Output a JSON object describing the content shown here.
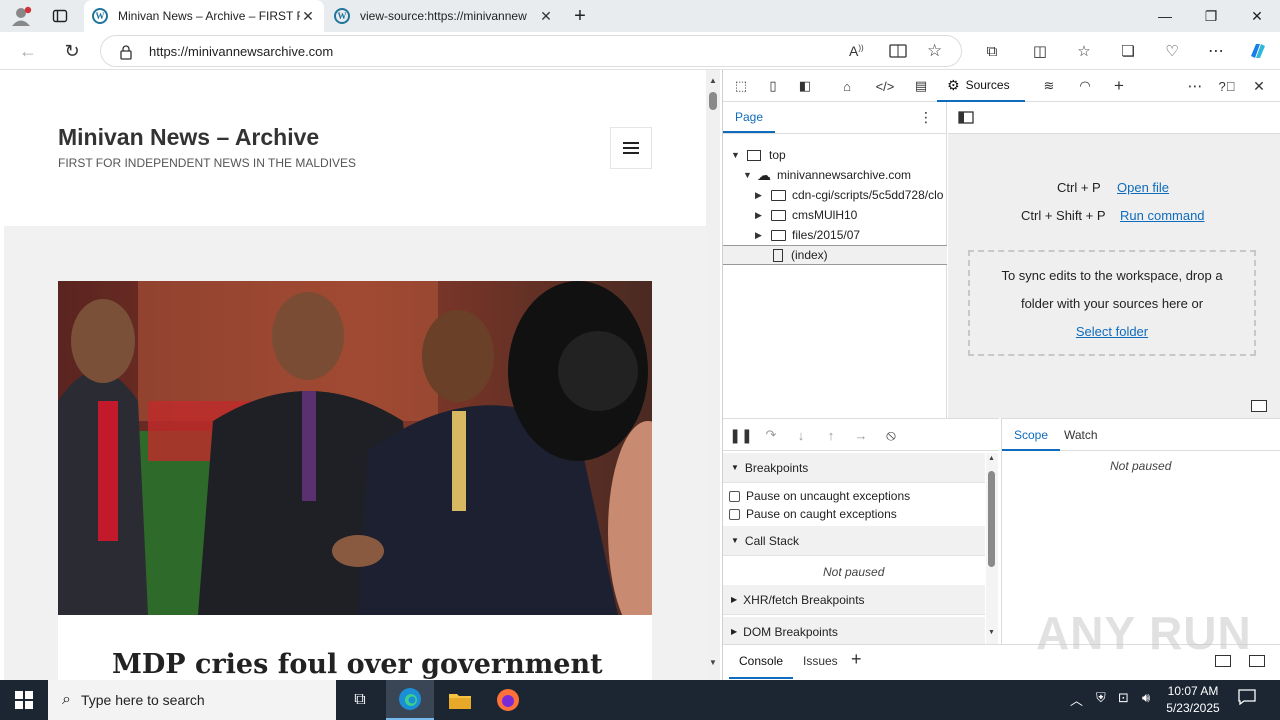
{
  "browser": {
    "tabs": [
      {
        "title": "Minivan News – Archive – FIRST F",
        "active": true
      },
      {
        "title": "view-source:https://minivannew",
        "active": false
      }
    ],
    "url": "https://minivannewsarchive.com"
  },
  "page": {
    "site_title": "Minivan News – Archive",
    "tagline": "FIRST FOR INDEPENDENT NEWS IN THE MALDIVES",
    "headline": "MDP cries foul over government"
  },
  "devtools": {
    "active_tab": "Sources",
    "navigator_tab": "Page",
    "tree": [
      {
        "label": "top",
        "level": 0,
        "kind": "frame",
        "expanded": true
      },
      {
        "label": "minivannewsarchive.com",
        "level": 1,
        "kind": "cloud",
        "expanded": true
      },
      {
        "label": "cdn-cgi/scripts/5c5dd728/clo",
        "level": 2,
        "kind": "folder",
        "expanded": false
      },
      {
        "label": "cmsMUlH10",
        "level": 2,
        "kind": "folder",
        "expanded": false
      },
      {
        "label": "files/2015/07",
        "level": 2,
        "kind": "folder",
        "expanded": false
      },
      {
        "label": "(index)",
        "level": 2,
        "kind": "file",
        "selected": true
      }
    ],
    "editor": {
      "shortcut1": "Ctrl + P",
      "action1": "Open file",
      "shortcut2": "Ctrl + Shift + P",
      "action2": "Run command",
      "drop_line1": "To sync edits to the workspace, drop a",
      "drop_line2": "folder with your sources here or",
      "drop_link": "Select folder"
    },
    "debugger": {
      "breakpoints": "Breakpoints",
      "pause_uncaught": "Pause on uncaught exceptions",
      "pause_caught": "Pause on caught exceptions",
      "call_stack": "Call Stack",
      "not_paused": "Not paused",
      "xhr": "XHR/fetch Breakpoints",
      "dom": "DOM Breakpoints"
    },
    "scope_tabs": [
      "Scope",
      "Watch"
    ],
    "scope_status": "Not paused",
    "drawer_tabs": [
      "Console",
      "Issues"
    ]
  },
  "watermark": "ANY RUN",
  "taskbar": {
    "search_placeholder": "Type here to search",
    "time": "10:07 AM",
    "date": "5/23/2025"
  }
}
